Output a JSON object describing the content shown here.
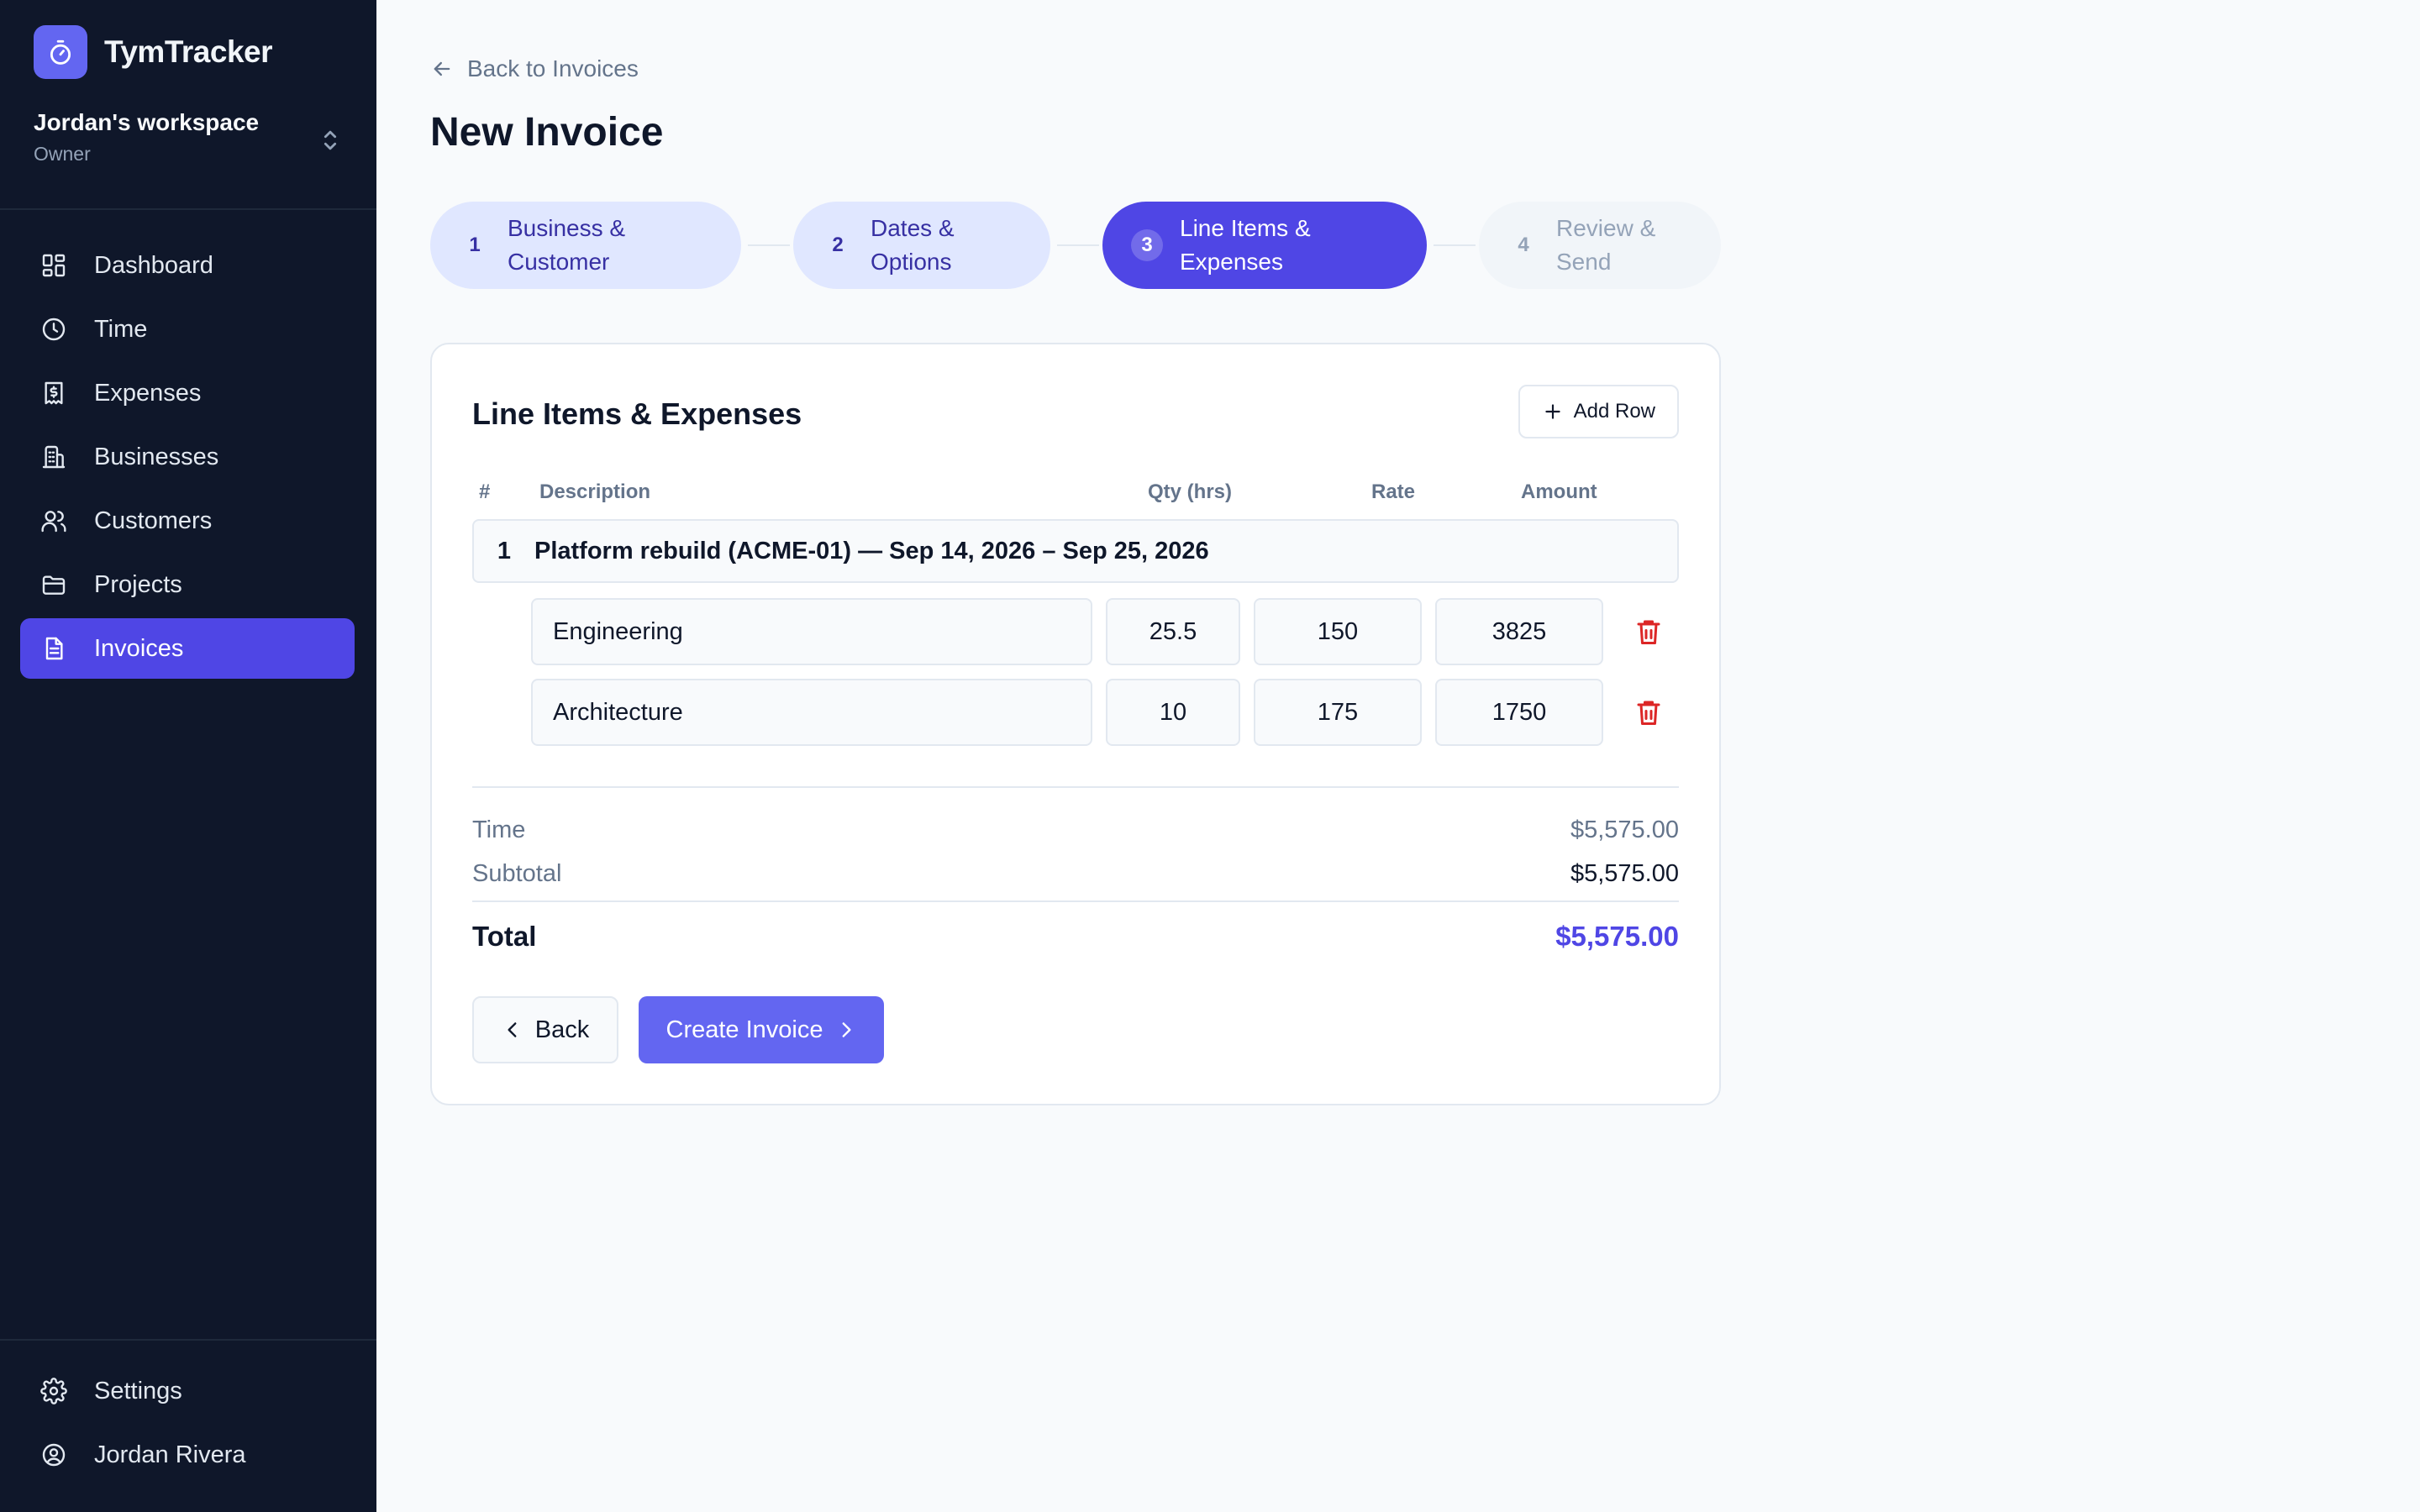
{
  "app": {
    "name": "TymTracker"
  },
  "workspace": {
    "name": "Jordan's workspace",
    "role": "Owner"
  },
  "sidebar": {
    "items": [
      {
        "label": "Dashboard",
        "icon": "dashboard-icon"
      },
      {
        "label": "Time",
        "icon": "clock-icon"
      },
      {
        "label": "Expenses",
        "icon": "receipt-icon"
      },
      {
        "label": "Businesses",
        "icon": "building-icon"
      },
      {
        "label": "Customers",
        "icon": "users-icon"
      },
      {
        "label": "Projects",
        "icon": "folder-icon"
      },
      {
        "label": "Invoices",
        "icon": "document-icon",
        "active": true
      }
    ],
    "bottom": [
      {
        "label": "Settings",
        "icon": "gear-icon"
      },
      {
        "label": "Jordan Rivera",
        "icon": "user-circle-icon"
      }
    ]
  },
  "header": {
    "back_link": "Back to Invoices",
    "title": "New Invoice"
  },
  "stepper": {
    "steps": [
      {
        "number": "1",
        "label": "Business & Customer",
        "state": "done"
      },
      {
        "number": "2",
        "label": "Dates & Options",
        "state": "done"
      },
      {
        "number": "3",
        "label": "Line Items & Expenses",
        "state": "current"
      },
      {
        "number": "4",
        "label": "Review & Send",
        "state": "todo"
      }
    ]
  },
  "line_items": {
    "title": "Line Items & Expenses",
    "add_row_label": "Add Row",
    "columns": {
      "num": "#",
      "description": "Description",
      "qty": "Qty (hrs)",
      "rate": "Rate",
      "amount": "Amount"
    },
    "group": {
      "number": "1",
      "label": "Platform rebuild (ACME-01) — Sep 14, 2026 – Sep 25, 2026"
    },
    "rows": [
      {
        "description": "Engineering",
        "qty": "25.5",
        "rate": "150",
        "amount": "3825"
      },
      {
        "description": "Architecture",
        "qty": "10",
        "rate": "175",
        "amount": "1750"
      }
    ]
  },
  "summary": {
    "time_label": "Time",
    "time_value": "$5,575.00",
    "subtotal_label": "Subtotal",
    "subtotal_value": "$5,575.00",
    "total_label": "Total",
    "total_value": "$5,575.00"
  },
  "actions": {
    "back_label": "Back",
    "create_label": "Create Invoice"
  },
  "colors": {
    "sidebar_bg": "#0f172a",
    "accent": "#4f46e5",
    "accent_light": "#e0e7ff",
    "danger": "#dc2626",
    "total": "#4f46e5"
  }
}
